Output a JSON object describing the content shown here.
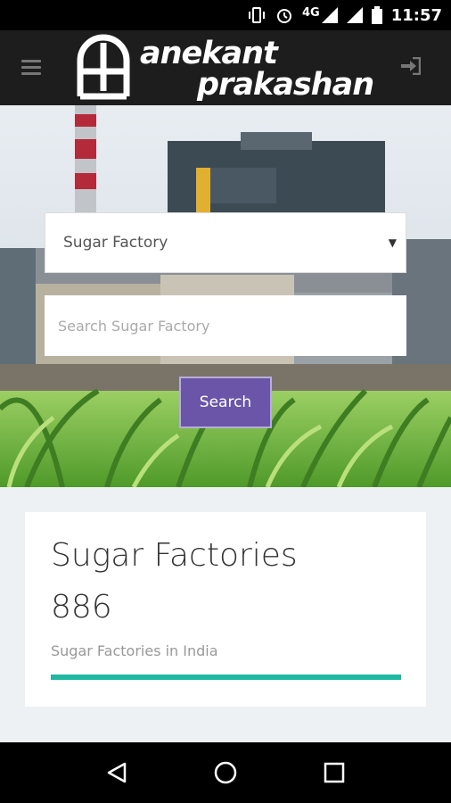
{
  "status_bar": {
    "network": "4G",
    "time": "11:57",
    "icons": [
      "vibrate-icon",
      "alarm-icon",
      "signal-icon",
      "signal-icon",
      "battery-icon"
    ]
  },
  "app_bar": {
    "menu_icon": "hamburger-menu-icon",
    "logo_mark": "AF",
    "logo_line1": "anekant",
    "logo_line2": "prakashan",
    "login_icon": "sign-in-icon"
  },
  "search": {
    "select_value": "Sugar Factory",
    "input_placeholder": "Search Sugar Factory",
    "button_label": "Search"
  },
  "stat_card": {
    "title": "Sugar Factories",
    "count": "886",
    "subtitle": "Sugar Factories in India",
    "progress": 1.0,
    "progress_color": "#1fb8a0"
  },
  "nav_bar": {
    "buttons": [
      "back-icon",
      "home-icon",
      "recents-icon"
    ]
  },
  "colors": {
    "appbar_bg": "#1d1d1d",
    "button_bg": "#6a55a8",
    "content_bg": "#eef1f4"
  }
}
